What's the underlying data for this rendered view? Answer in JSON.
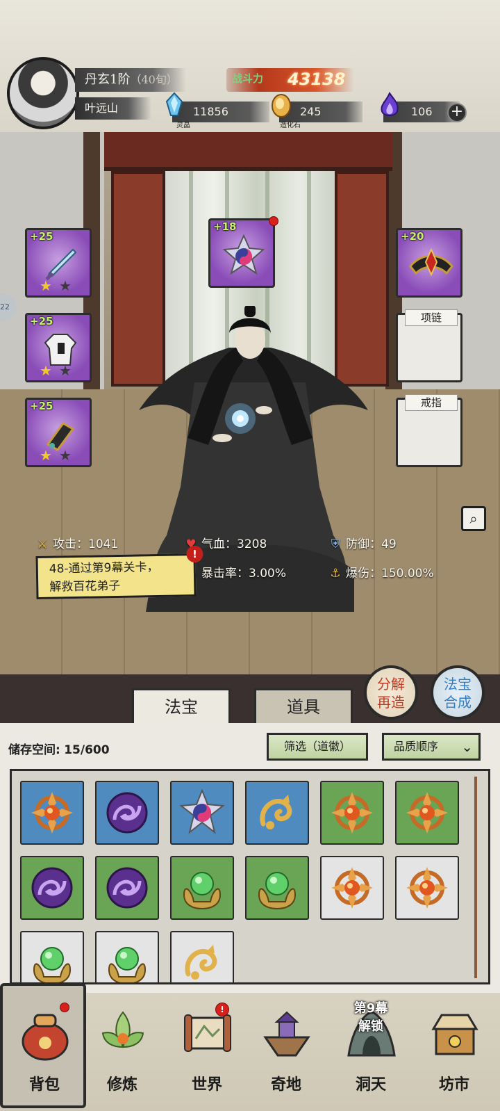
{
  "player": {
    "realm": "丹玄1阶",
    "realm_age": "（40旬）",
    "name": "叶远山",
    "power_label": "战斗力",
    "power": "43138"
  },
  "resources": [
    {
      "icon": "spirit-crystal-icon",
      "label": "灵晶",
      "value": "11856"
    },
    {
      "icon": "creation-stone-icon",
      "label": "造化石",
      "value": "245"
    },
    {
      "icon": "purple-flame-icon",
      "label": "",
      "value": "106"
    }
  ],
  "side_badge": "22",
  "equipment": {
    "weapon": {
      "level": "+25",
      "stars": 1
    },
    "robe": {
      "level": "+25",
      "stars": 1
    },
    "bracer": {
      "level": "+25",
      "stars": 1
    },
    "treasure": {
      "level": "+18"
    },
    "crown": {
      "level": "+20"
    },
    "necklace": {
      "label": "项链"
    },
    "ring": {
      "label": "戒指"
    }
  },
  "stats": {
    "attack": "攻击：1041",
    "hp": "气血：3208",
    "defense": "防御：49",
    "crit_rate": "暴击率：3.00%",
    "crit_damage": "爆伤：150.00%"
  },
  "quest": {
    "line1": "48-通过第9幕关卡，",
    "line2": "解救百花弟子",
    "alert": "!"
  },
  "actions": {
    "decompose": [
      "分解",
      "再造"
    ],
    "synthesize": [
      "法宝",
      "合成"
    ]
  },
  "tabs": [
    "法宝",
    "道具"
  ],
  "storage": {
    "label": "储存空间:",
    "value": "15/600",
    "filter_label": "筛选（道徽）",
    "sort_label": "品质顺序"
  },
  "inventory": [
    {
      "bg": "blue",
      "icon": "sun-disc-icon"
    },
    {
      "bg": "blue",
      "icon": "purple-swirl-icon"
    },
    {
      "bg": "blue",
      "icon": "yinyang-star-icon"
    },
    {
      "bg": "blue",
      "icon": "golden-dragon-icon"
    },
    {
      "bg": "green",
      "icon": "sun-disc-icon"
    },
    {
      "bg": "green",
      "icon": "sun-disc-icon"
    },
    {
      "bg": "green",
      "icon": "purple-swirl-icon"
    },
    {
      "bg": "green",
      "icon": "purple-swirl-icon"
    },
    {
      "bg": "green",
      "icon": "jade-orb-icon"
    },
    {
      "bg": "green",
      "icon": "jade-orb-icon"
    },
    {
      "bg": "white",
      "icon": "sun-disc-icon"
    },
    {
      "bg": "white",
      "icon": "sun-disc-icon"
    },
    {
      "bg": "white",
      "icon": "jade-orb-icon"
    },
    {
      "bg": "white",
      "icon": "jade-orb-icon"
    },
    {
      "bg": "white",
      "icon": "golden-dragon-icon"
    }
  ],
  "nav": [
    {
      "label": "背包",
      "icon": "bag-icon"
    },
    {
      "label": "修炼",
      "icon": "lotus-icon"
    },
    {
      "label": "世界",
      "icon": "scroll-map-icon"
    },
    {
      "label": "奇地",
      "icon": "floating-island-icon"
    },
    {
      "label": "洞天",
      "icon": "cave-icon",
      "lock_line1": "第9幕",
      "lock_line2": "解锁"
    },
    {
      "label": "坊市",
      "icon": "market-icon"
    }
  ]
}
